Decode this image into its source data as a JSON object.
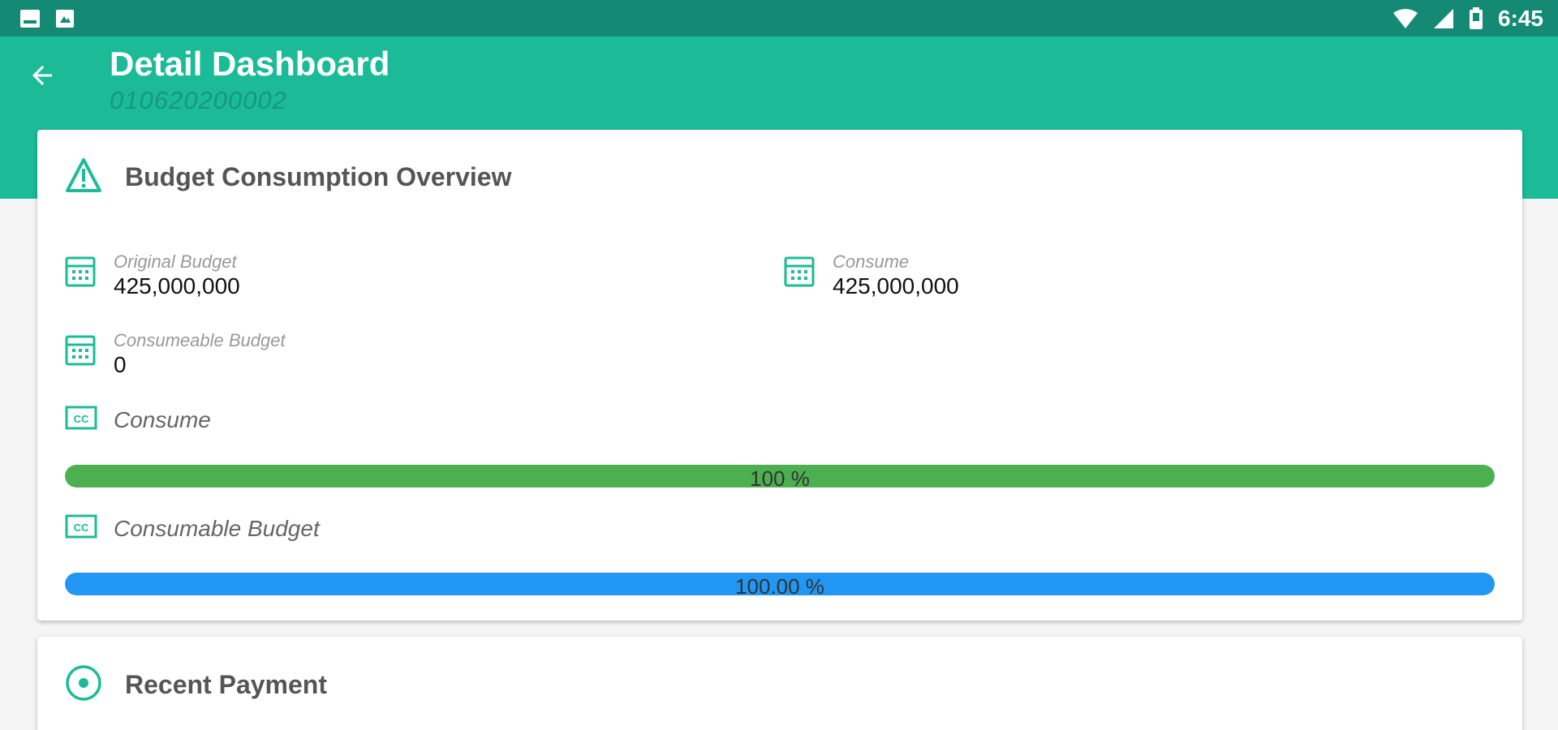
{
  "status_bar": {
    "time": "6:45",
    "left_icons": [
      "image-notification-icon",
      "photo-notification-icon"
    ],
    "right_icons": [
      "wifi-icon",
      "cell-signal-icon",
      "battery-icon"
    ]
  },
  "app_bar": {
    "title": "Detail Dashboard",
    "subtitle": "010620200002",
    "back_icon": "arrow-back-icon",
    "color": "#1cbb98",
    "status_color": "#148a74"
  },
  "budget_card": {
    "title": "Budget Consumption Overview",
    "header_icon": "warning-triangle-icon",
    "original_budget": {
      "label": "Original Budget",
      "value": "425,000,000",
      "icon": "calculator-icon"
    },
    "consume": {
      "label": "Consume",
      "value": "425,000,000",
      "icon": "calculator-icon"
    },
    "consumeable_budget": {
      "label": "Consumeable Budget",
      "value": "0",
      "icon": "calculator-icon"
    },
    "consume_progress": {
      "label": "Consume",
      "icon": "cc-icon",
      "percent": 100,
      "text": "100 %",
      "color": "#4caf50"
    },
    "consumable_progress": {
      "label": "Consumable Budget",
      "icon": "cc-icon",
      "percent": 100,
      "text": "100.00 %",
      "color": "#2196f3"
    }
  },
  "payment_card": {
    "title": "Recent Payment",
    "header_icon": "radio-target-icon"
  }
}
